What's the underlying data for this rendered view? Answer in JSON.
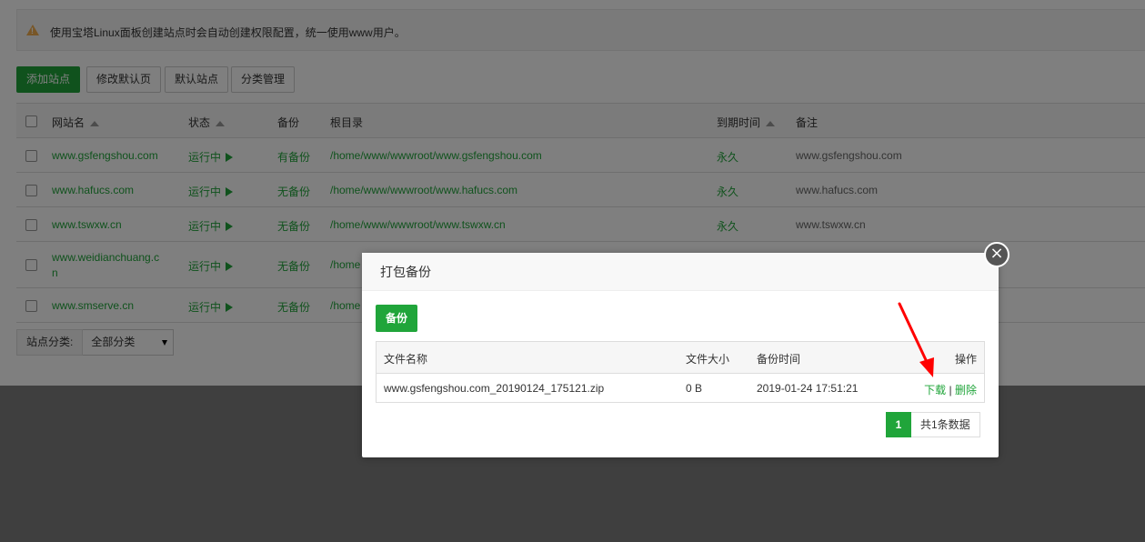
{
  "notice": "使用宝塔Linux面板创建站点时会自动创建权限配置，统一使用www用户。",
  "toolbar": {
    "add_site": "添加站点",
    "edit_default_page": "修改默认页",
    "default_site": "默认站点",
    "category_manage": "分类管理"
  },
  "table": {
    "headers": {
      "name": "网站名",
      "status": "状态",
      "backup": "备份",
      "root": "根目录",
      "expire": "到期时间",
      "note": "备注"
    },
    "rows": [
      {
        "name": "www.gsfengshou.com",
        "status": "运行中",
        "backup": "有备份",
        "root": "/home/www/wwwroot/www.gsfengshou.com",
        "expire": "永久",
        "note": "www.gsfengshou.com"
      },
      {
        "name": "www.hafucs.com",
        "status": "运行中",
        "backup": "无备份",
        "root": "/home/www/wwwroot/www.hafucs.com",
        "expire": "永久",
        "note": "www.hafucs.com"
      },
      {
        "name": "www.tswxw.cn",
        "status": "运行中",
        "backup": "无备份",
        "root": "/home/www/wwwroot/www.tswxw.cn",
        "expire": "永久",
        "note": "www.tswxw.cn"
      },
      {
        "name_line1": "www.weidianchuang.c",
        "name_line2": "n",
        "status": "运行中",
        "backup": "无备份",
        "root": "/home"
      },
      {
        "name": "www.smserve.cn",
        "status": "运行中",
        "backup": "无备份",
        "root": "/home"
      }
    ]
  },
  "filter": {
    "label": "站点分类:",
    "selected": "全部分类"
  },
  "modal": {
    "title": "打包备份",
    "backup_button": "备份",
    "headers": {
      "filename": "文件名称",
      "size": "文件大小",
      "time": "备份时间",
      "action": "操作"
    },
    "rows": [
      {
        "filename": "www.gsfengshou.com_20190124_175121.zip",
        "size": "0 B",
        "time": "2019-01-24 17:51:21",
        "download": "下载",
        "sep": "|",
        "delete": "删除"
      }
    ],
    "pager": {
      "current": "1",
      "total": "共1条数据"
    },
    "close_glyph": "×"
  },
  "colors": {
    "accent": "#20a53a",
    "warning": "#f0ad4e",
    "annotation_arrow": "#ff0000"
  }
}
